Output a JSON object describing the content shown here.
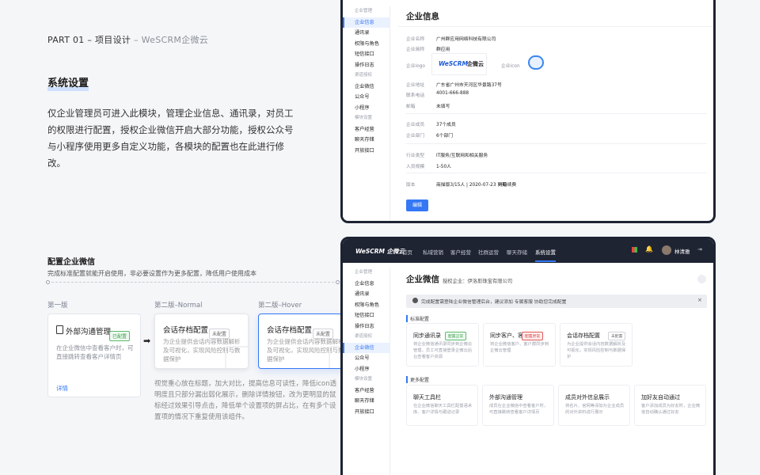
{
  "header": {
    "part": "PART 01 – 项目设计",
    "part_sub": " – WeSCRM企微云"
  },
  "section": {
    "title": "系统设置",
    "description": "仅企业管理员可进入此模块，管理企业信息、通讯录，对员工的权限进行配置，授权企业微信开启大部分功能，授权公众号与小程序使用更多自定义功能，各模块的配置也在此进行修改。"
  },
  "config": {
    "title": "配置企业微信",
    "subtitle": "完成标准配置就能开启使用，非必要设置作为更多配置，降低用户使用成本"
  },
  "versions": [
    {
      "label": "第一版",
      "title": "外部沟通管理",
      "tag": "已配置",
      "desc": "在企业微信中查看客户时，可直接跳转查看客户详情页",
      "link": "详情"
    },
    {
      "label": "第二版–Normal",
      "title": "会话存档配置",
      "tag": "未配置",
      "desc": "为企业提供会话内容数据解析及可视化，实现风险控制与数据保护"
    },
    {
      "label": "第二版–Hover",
      "title": "会话存档配置",
      "tag": "未配置",
      "desc": "为企业提供会话内容数据解析及可视化，实现风险控制与数据保护"
    }
  ],
  "note": "视觉重心放在标题，加大对比，提高信息可读性，降低icon透明度且只部分漏出弱化展示，删除详情按钮，改为更明显的鼠标经过效果引导点击，降低单个设置项的屏占比，在有多个设置项的情况下重复使用该组件。",
  "win1": {
    "sidebar": [
      {
        "label": "企业管理",
        "type": "grp"
      },
      {
        "label": "企业信息",
        "type": "act"
      },
      {
        "label": "通讯录"
      },
      {
        "label": "权限与角色"
      },
      {
        "label": "短信接口"
      },
      {
        "label": "操作日志"
      },
      {
        "label": "渠道授权",
        "type": "grp"
      },
      {
        "label": "企业微信"
      },
      {
        "label": "公众号"
      },
      {
        "label": "小程序"
      },
      {
        "label": "模块设置",
        "type": "grp"
      },
      {
        "label": "客户经营"
      },
      {
        "label": "聊天存储"
      },
      {
        "label": "开放接口"
      }
    ],
    "title": "企业信息",
    "company_name_label": "企业名称",
    "company_name": "广州群应用网络科技有限公司",
    "short_label": "企业简称",
    "short": "群应用",
    "logo_label": "企业logo",
    "logo_text": "WeSCRM",
    "logo_cn": "企微云",
    "icon_label": "企业icon",
    "addr_label": "企业地址",
    "addr": "广东省广州市天河区华景路37号",
    "phone_label": "联系电话",
    "phone": "4001-666-888",
    "email_label": "邮箱",
    "email": "未填写",
    "members_label": "企业成员",
    "members": "37个成员",
    "depts_label": "企业部门",
    "depts": "6个部门",
    "industry_label": "行业类型",
    "industry": "IT服务/互联网和相关服务",
    "scale_label": "人员规模",
    "scale": "1-50人",
    "version_label": "版本",
    "version": "商描版3/15人 | 2020-07-23 到期",
    "upgrade": "升级续费",
    "edit": "编辑"
  },
  "win2": {
    "brand": "WeSCRM 企微云",
    "nav": [
      "首页",
      "私域营销",
      "客户经营",
      "社群运营",
      "聊天存储",
      "系统设置"
    ],
    "user": "林清雅",
    "sidebar": [
      {
        "label": "企业管理",
        "type": "grp"
      },
      {
        "label": "企业信息"
      },
      {
        "label": "通讯录"
      },
      {
        "label": "权限与角色"
      },
      {
        "label": "短信接口"
      },
      {
        "label": "操作日志"
      },
      {
        "label": "渠道授权",
        "type": "grp"
      },
      {
        "label": "企业微信",
        "type": "act"
      },
      {
        "label": "公众号"
      },
      {
        "label": "小程序"
      },
      {
        "label": "模块设置",
        "type": "grp"
      },
      {
        "label": "客户经营"
      },
      {
        "label": "聊天存储"
      },
      {
        "label": "开放接口"
      }
    ],
    "title": "企业微信",
    "auth": "授权企业：伊洛斯珠宝有限公司",
    "alert": "完成配置需登陆企业微信管理后台，建议添加 专属客服 协助您完成配置",
    "std_label": "标准配置",
    "more_label": "更多配置",
    "std": [
      {
        "title": "同步通讯录",
        "tag": "配置正常",
        "tagtype": "green",
        "desc": "将企业微信通讯录同步到企微云管理，员工可直接登录企微云后台查看客户资源"
      },
      {
        "title": "同步客户、客...",
        "tag": "配置异常",
        "tagtype": "red",
        "desc": "将企业微信客户、客户群同步到企微云管理"
      },
      {
        "title": "会话存档配置",
        "tag": "未配置",
        "tagtype": "",
        "desc": "为企业提供会话内容数据解析及可视化，实现风险控制与数据保护"
      }
    ],
    "more": [
      {
        "title": "聊天工具栏",
        "desc": "在企业微信聊天工具栏配置语术库、客户详情与跟进记录"
      },
      {
        "title": "外部沟通管理",
        "desc": "成员在企业微信中查看客户时，可直接跳转查看客户详情页"
      },
      {
        "title": "成员对外信息展示",
        "desc": "将名片、官网等添加为企业成员的对外资料进行展示"
      },
      {
        "title": "加好友自动通过",
        "desc": "客户添加成员为好友时，企业微信自动确认通过好友"
      }
    ]
  }
}
